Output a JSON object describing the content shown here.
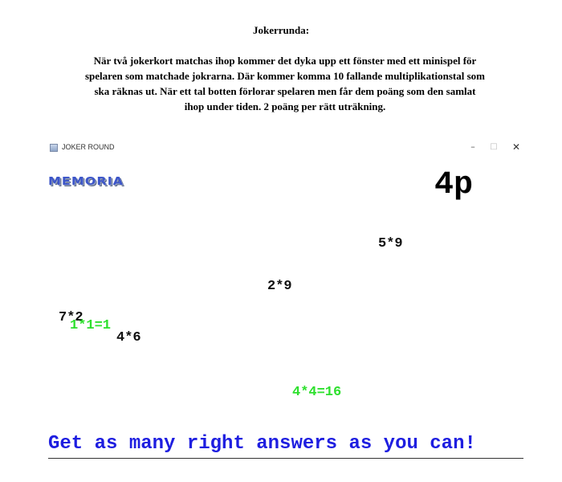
{
  "document": {
    "heading": "Jokerrunda:",
    "paragraph": "När två jokerkort matchas ihop kommer det dyka upp ett fönster med ett minispel för spelaren som matchade jokrarna. Där kommer komma 10 fallande multiplikationstal som ska räknas ut. När ett tal botten förlorar spelaren men får dem poäng som den samlat ihop under tiden. 2 poäng per rätt uträkning."
  },
  "window": {
    "title": "JOKER ROUND",
    "icon": "java-cup-icon",
    "controls": {
      "minimize": "–",
      "maximize": "□",
      "close": "✕"
    }
  },
  "game": {
    "logo": "MEMORIA",
    "score": "4p",
    "tasks": [
      {
        "text": "5*9",
        "color": "#111111"
      },
      {
        "text": "2*9",
        "color": "#111111"
      },
      {
        "text": "7*2",
        "color": "#111111"
      },
      {
        "text": "1*1=1",
        "color": "#2ee02e"
      },
      {
        "text": "4*6",
        "color": "#111111"
      },
      {
        "text": "4*4=16",
        "color": "#2ee02e"
      }
    ],
    "footer": "Get as many right answers as you can!",
    "colors": {
      "correct": "#2ee02e",
      "pending": "#111111",
      "message": "#1e1ee0"
    }
  }
}
